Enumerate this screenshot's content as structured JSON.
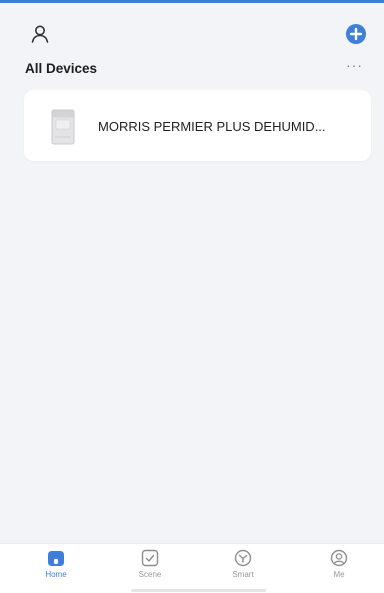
{
  "colors": {
    "accent": "#3f7fd9",
    "background": "#f3f4f8",
    "card": "#ffffff",
    "inactive": "#9a9a9a"
  },
  "header": {
    "profile_icon": "person-outline-icon",
    "add_icon": "plus-circle-icon",
    "section_title": "All Devices",
    "more_label": "···"
  },
  "devices": [
    {
      "icon": "dehumidifier-icon",
      "name": "MORRIS PERMIER PLUS DEHUMID..."
    }
  ],
  "tabbar": {
    "tabs": [
      {
        "label": "Home",
        "icon": "home-icon",
        "active": true
      },
      {
        "label": "Scene",
        "icon": "scene-check-icon",
        "active": false
      },
      {
        "label": "Smart",
        "icon": "smart-icon",
        "active": false
      },
      {
        "label": "Me",
        "icon": "me-face-icon",
        "active": false
      }
    ]
  }
}
